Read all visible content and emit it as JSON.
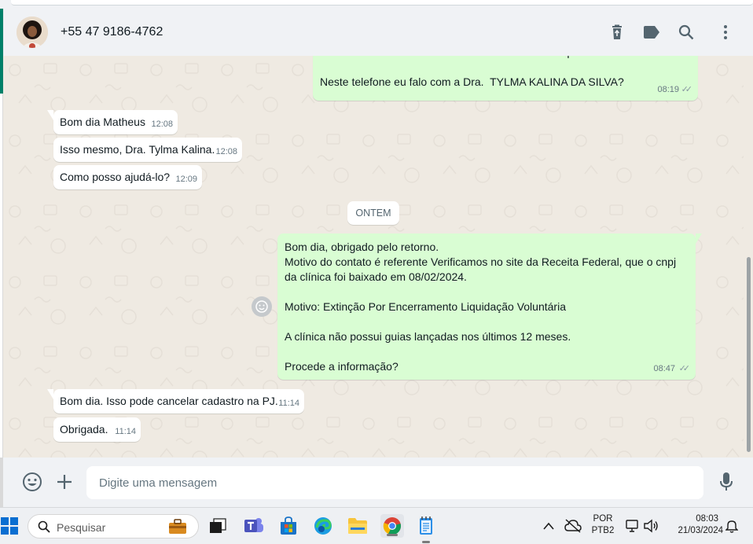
{
  "header": {
    "contact": "+55 47 9186-4762",
    "icons": [
      "trash-icon",
      "label-icon",
      "search-icon",
      "menu-icon"
    ]
  },
  "messages": {
    "m0": {
      "text": "Me chamo Matheus e falo em nome da Odontolife parceira com Dentalonl.\n\nNeste telefone eu falo com a Dra.  TYLMA KALINA DA SILVA?",
      "time": "08:19"
    },
    "m1": {
      "text": "Bom dia Matheus",
      "time": "12:08"
    },
    "m2": {
      "text": "Isso mesmo, Dra. Tylma Kalina.",
      "time": "12:08"
    },
    "m3": {
      "text": "Como posso ajudá-lo?",
      "time": "12:09"
    },
    "m4": {
      "text": "Bom dia, obrigado pelo retorno.\nMotivo do contato é referente Verificamos no site da Receita Federal, que o cnpj da clínica foi baixado em 08/02/2024.\n\nMotivo: Extinção Por Encerramento Liquidação Voluntária\n\nA clínica não possui guias lançadas nos últimos 12 meses.\n\nProcede a informação?",
      "time": "08:47"
    },
    "m5": {
      "text": "Bom dia. Isso pode cancelar cadastro na PJ.",
      "time": "11:14"
    },
    "m6": {
      "text": "Obrigada.",
      "time": "11:14"
    }
  },
  "date_separator": "ONTEM",
  "composer": {
    "placeholder": "Digite uma mensagem"
  },
  "taskbar": {
    "search_placeholder": "Pesquisar",
    "language_1": "POR",
    "language_2": "PTB2",
    "clock_time": "08:03",
    "clock_date": "21/03/2024"
  },
  "colors": {
    "incoming_bubble": "#ffffff",
    "outgoing_bubble": "#d9fdd3",
    "chat_bg": "#efeae2",
    "brand_green": "#008069"
  }
}
